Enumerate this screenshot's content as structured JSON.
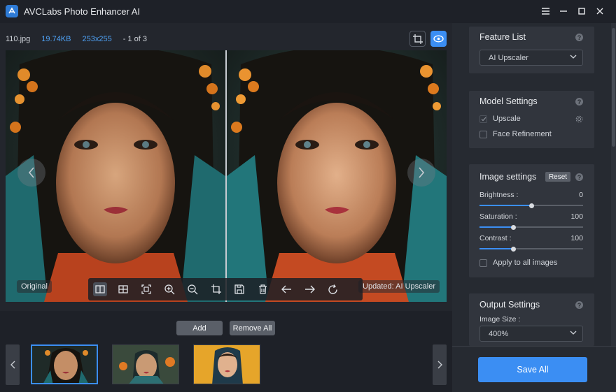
{
  "app": {
    "title": "AVCLabs Photo Enhancer AI"
  },
  "window_controls": [
    "menu-icon",
    "minimize-icon",
    "maximize-icon",
    "close-icon"
  ],
  "file_info": {
    "name": "110.jpg",
    "size": "19.74KB",
    "dimensions": "253x255",
    "position": "- 1 of 3"
  },
  "viewer": {
    "label_original": "Original",
    "label_updated": "Updated: AI Upscaler"
  },
  "toolbar": {
    "icons": [
      "compare-split-icon",
      "grid-icon",
      "fit-screen-icon",
      "zoom-in-icon",
      "zoom-out-icon",
      "crop-icon",
      "save-icon",
      "delete-icon",
      "arrow-left-icon",
      "arrow-right-icon",
      "rotate-icon"
    ]
  },
  "strip": {
    "add_label": "Add",
    "remove_all_label": "Remove All",
    "thumb_count": 3
  },
  "panel": {
    "feature_list": {
      "title": "Feature List",
      "selected": "AI Upscaler"
    },
    "model_settings": {
      "title": "Model Settings",
      "upscale_label": "Upscale",
      "upscale_checked": true,
      "face_label": "Face Refinement",
      "face_checked": false
    },
    "image_settings": {
      "title": "Image settings",
      "reset_label": "Reset",
      "brightness": {
        "label": "Brightness :",
        "value": "0",
        "fraction": 0.5
      },
      "saturation": {
        "label": "Saturation :",
        "value": "100",
        "fraction": 0.33
      },
      "contrast": {
        "label": "Contrast :",
        "value": "100",
        "fraction": 0.33
      },
      "apply_all_label": "Apply to all images"
    },
    "output_settings": {
      "title": "Output Settings",
      "size_label": "Image Size :",
      "size_value": "400%"
    },
    "save_all_label": "Save All"
  },
  "colors": {
    "accent": "#3b8ef3",
    "info_blue": "#4ea1f5",
    "bg": "#1e2128",
    "panel": "#262a31",
    "card": "#31353d"
  }
}
